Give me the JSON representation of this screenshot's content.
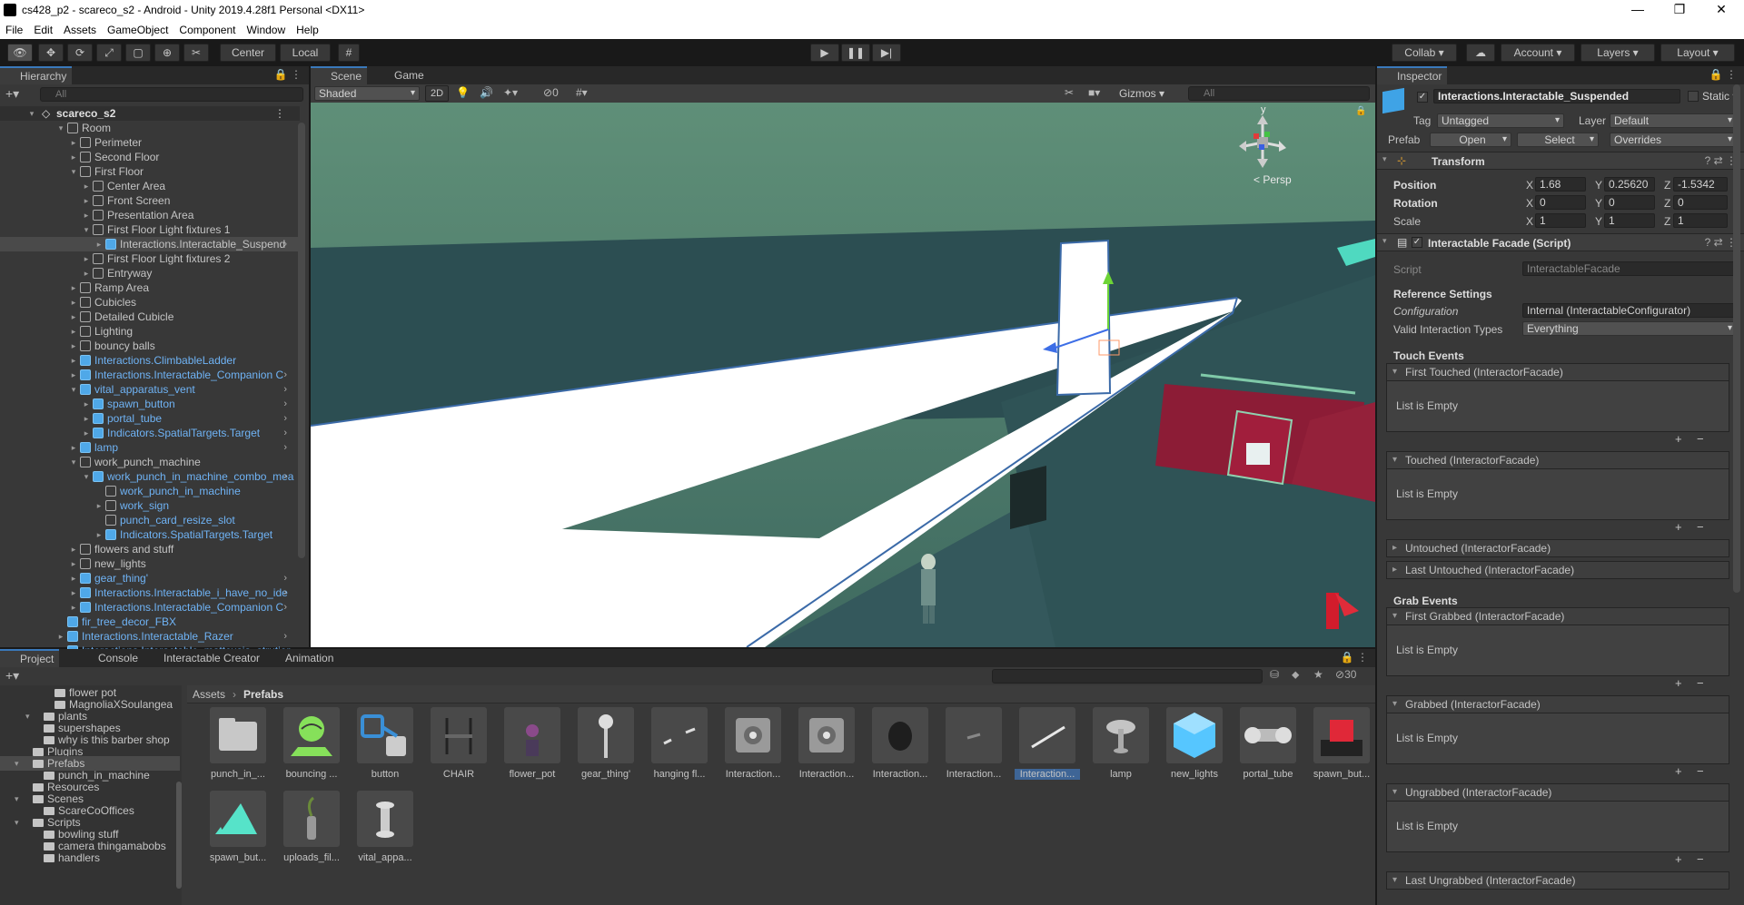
{
  "window": {
    "title": "cs428_p2 - scareco_s2 - Android - Unity 2019.4.28f1 Personal <DX11>"
  },
  "menu": [
    "File",
    "Edit",
    "Assets",
    "GameObject",
    "Component",
    "Window",
    "Help"
  ],
  "toolbar": {
    "pivot": "Center",
    "space": "Local",
    "collab": "Collab",
    "account": "Account",
    "layers": "Layers",
    "layout": "Layout"
  },
  "hierarchy": {
    "tab": "Hierarchy",
    "search_placeholder": "All",
    "scene": "scareco_s2",
    "rows": [
      {
        "label": "Room",
        "depth": 1,
        "exp": "open",
        "icon": "gray",
        "blue": false
      },
      {
        "label": "Perimeter",
        "depth": 2,
        "exp": "closed",
        "icon": "gray",
        "blue": false
      },
      {
        "label": "Second Floor",
        "depth": 2,
        "exp": "closed",
        "icon": "gray",
        "blue": false
      },
      {
        "label": "First Floor",
        "depth": 2,
        "exp": "open",
        "icon": "gray",
        "blue": false
      },
      {
        "label": "Center Area",
        "depth": 3,
        "exp": "closed",
        "icon": "gray",
        "blue": false
      },
      {
        "label": "Front Screen",
        "depth": 3,
        "exp": "closed",
        "icon": "gray",
        "blue": false
      },
      {
        "label": "Presentation Area",
        "depth": 3,
        "exp": "closed",
        "icon": "gray",
        "blue": false
      },
      {
        "label": "First Floor Light fixtures 1",
        "depth": 3,
        "exp": "open",
        "icon": "gray",
        "blue": false
      },
      {
        "label": "Interactions.Interactable_Suspend",
        "depth": 4,
        "exp": "closed",
        "icon": "blue",
        "blue": false,
        "sel": true,
        "more": true
      },
      {
        "label": "First Floor Light fixtures 2",
        "depth": 3,
        "exp": "closed",
        "icon": "gray",
        "blue": false
      },
      {
        "label": "Entryway",
        "depth": 3,
        "exp": "closed",
        "icon": "gray",
        "blue": false
      },
      {
        "label": "Ramp Area",
        "depth": 2,
        "exp": "closed",
        "icon": "gray",
        "blue": false
      },
      {
        "label": "Cubicles",
        "depth": 2,
        "exp": "closed",
        "icon": "gray",
        "blue": false
      },
      {
        "label": "Detailed Cubicle",
        "depth": 2,
        "exp": "closed",
        "icon": "gray",
        "blue": false
      },
      {
        "label": "Lighting",
        "depth": 2,
        "exp": "closed",
        "icon": "gray",
        "blue": false
      },
      {
        "label": "bouncy balls",
        "depth": 2,
        "exp": "closed",
        "icon": "gray",
        "blue": false
      },
      {
        "label": "Interactions.ClimbableLadder",
        "depth": 2,
        "exp": "closed",
        "icon": "blue",
        "blue": true
      },
      {
        "label": "Interactions.Interactable_Companion C",
        "depth": 2,
        "exp": "closed",
        "icon": "blue",
        "blue": true,
        "more": true
      },
      {
        "label": "vital_apparatus_vent",
        "depth": 2,
        "exp": "open",
        "icon": "blue",
        "blue": true,
        "more": true
      },
      {
        "label": "spawn_button",
        "depth": 3,
        "exp": "closed",
        "icon": "blue",
        "blue": true,
        "more": true
      },
      {
        "label": "portal_tube",
        "depth": 3,
        "exp": "closed",
        "icon": "blue",
        "blue": true,
        "more": true
      },
      {
        "label": "Indicators.SpatialTargets.Target",
        "depth": 3,
        "exp": "closed",
        "icon": "blue",
        "blue": true,
        "more": true
      },
      {
        "label": "lamp",
        "depth": 2,
        "exp": "closed",
        "icon": "blue",
        "blue": true,
        "more": true
      },
      {
        "label": "work_punch_machine",
        "depth": 2,
        "exp": "open",
        "icon": "gray",
        "blue": false
      },
      {
        "label": "work_punch_in_machine_combo_mea",
        "depth": 3,
        "exp": "open",
        "icon": "blue",
        "blue": true,
        "more": true
      },
      {
        "label": "work_punch_in_machine",
        "depth": 4,
        "exp": "none",
        "icon": "gray",
        "blue": true
      },
      {
        "label": "work_sign",
        "depth": 4,
        "exp": "closed",
        "icon": "gray",
        "blue": true
      },
      {
        "label": "punch_card_resize_slot",
        "depth": 4,
        "exp": "none",
        "icon": "gray",
        "blue": true
      },
      {
        "label": "Indicators.SpatialTargets.Target",
        "depth": 4,
        "exp": "closed",
        "icon": "blue",
        "blue": true
      },
      {
        "label": "flowers and stuff",
        "depth": 2,
        "exp": "closed",
        "icon": "gray",
        "blue": false
      },
      {
        "label": "new_lights",
        "depth": 2,
        "exp": "closed",
        "icon": "gray",
        "blue": false
      },
      {
        "label": "gear_thing'",
        "depth": 2,
        "exp": "closed",
        "icon": "blue",
        "blue": true,
        "more": true
      },
      {
        "label": "Interactions.Interactable_i_have_no_ide",
        "depth": 2,
        "exp": "closed",
        "icon": "blue",
        "blue": true,
        "more": true
      },
      {
        "label": "Interactions.Interactable_Companion C",
        "depth": 2,
        "exp": "closed",
        "icon": "blue",
        "blue": true,
        "more": true
      },
      {
        "label": "fir_tree_decor_FBX",
        "depth": 1,
        "exp": "none",
        "icon": "blue",
        "blue": true
      },
      {
        "label": "Interactions.Interactable_Razer",
        "depth": 1,
        "exp": "closed",
        "icon": "blue",
        "blue": true,
        "more": true
      },
      {
        "label": "Interactions.Interactable_mattcusia_strutier",
        "depth": 1,
        "exp": "closed",
        "icon": "blue",
        "blue": true
      }
    ]
  },
  "scene": {
    "tab_scene": "Scene",
    "tab_game": "Game",
    "shading": "Shaded",
    "mode2d": "2D",
    "hidden_count": "0",
    "gizmos": "Gizmos",
    "search_placeholder": "All",
    "persp": "Persp",
    "axis_y": "y"
  },
  "inspector": {
    "tab": "Inspector",
    "object_name": "Interactions.Interactable_Suspended",
    "static": "Static",
    "tag_label": "Tag",
    "tag": "Untagged",
    "layer_label": "Layer",
    "layer": "Default",
    "prefab_label": "Prefab",
    "open": "Open",
    "select": "Select",
    "overrides": "Overrides",
    "transform": "Transform",
    "position_label": "Position",
    "pos_x": "1.68",
    "pos_y": "0.25620",
    "pos_z": "-1.5342",
    "rotation_label": "Rotation",
    "rot_x": "0",
    "rot_y": "0",
    "rot_z": "0",
    "scale_label": "Scale",
    "scl_x": "1",
    "scl_y": "1",
    "scl_z": "1",
    "component": "Interactable Facade (Script)",
    "script_label": "Script",
    "script": "InteractableFacade",
    "ref_settings": "Reference Settings",
    "config_label": "Configuration",
    "config": "Internal (InteractableConfigurator)",
    "valid_label": "Valid Interaction Types",
    "valid": "Everything",
    "touch_events": "Touch Events",
    "grab_events": "Grab Events",
    "ev_first_touched": "First Touched (InteractorFacade)",
    "ev_touched": "Touched (InteractorFacade)",
    "ev_untouched": "Untouched (InteractorFacade)",
    "ev_last_untouched": "Last Untouched (InteractorFacade)",
    "ev_first_grabbed": "First Grabbed (InteractorFacade)",
    "ev_grabbed": "Grabbed (InteractorFacade)",
    "ev_ungrabbed": "Ungrabbed (InteractorFacade)",
    "ev_last_ungrabbed": "Last Ungrabbed (InteractorFacade)",
    "list_empty": "List is Empty"
  },
  "project": {
    "tabs": [
      "Project",
      "Console",
      "Interactable Creator",
      "Animation"
    ],
    "hidden_count": "30",
    "breadcrumb_root": "Assets",
    "breadcrumb_leaf": "Prefabs",
    "tree": [
      {
        "label": "flower pot",
        "depth": 2,
        "exp": false
      },
      {
        "label": "MagnoliaXSoulangea",
        "depth": 2,
        "exp": false
      },
      {
        "label": "plants",
        "depth": 1,
        "exp": true
      },
      {
        "label": "supershapes",
        "depth": 1,
        "exp": false
      },
      {
        "label": "why is this barber shop",
        "depth": 1,
        "exp": false
      },
      {
        "label": "Plugins",
        "depth": 0,
        "exp": false
      },
      {
        "label": "Prefabs",
        "depth": 0,
        "exp": true,
        "sel": true
      },
      {
        "label": "punch_in_machine",
        "depth": 1,
        "exp": false
      },
      {
        "label": "Resources",
        "depth": 0,
        "exp": false
      },
      {
        "label": "Scenes",
        "depth": 0,
        "exp": true
      },
      {
        "label": "ScareCoOffices",
        "depth": 1,
        "exp": false
      },
      {
        "label": "Scripts",
        "depth": 0,
        "exp": true
      },
      {
        "label": "bowling stuff",
        "depth": 1,
        "exp": false
      },
      {
        "label": "camera thingamabobs",
        "depth": 1,
        "exp": false
      },
      {
        "label": "handlers",
        "depth": 1,
        "exp": false
      }
    ],
    "assets": [
      {
        "name": "punch_in_...",
        "kind": "folder"
      },
      {
        "name": "bouncing ...",
        "kind": "bouncing"
      },
      {
        "name": "button",
        "kind": "button"
      },
      {
        "name": "CHAIR",
        "kind": "chair"
      },
      {
        "name": "flower_pot",
        "kind": "flower"
      },
      {
        "name": "gear_thing'",
        "kind": "gear"
      },
      {
        "name": "hanging fl...",
        "kind": "hanging"
      },
      {
        "name": "Interaction...",
        "kind": "cube"
      },
      {
        "name": "Interaction...",
        "kind": "cube"
      },
      {
        "name": "Interaction...",
        "kind": "ball"
      },
      {
        "name": "Interaction...",
        "kind": "flat"
      },
      {
        "name": "Interaction...",
        "kind": "line",
        "sel": true
      },
      {
        "name": "lamp",
        "kind": "lamp"
      },
      {
        "name": "new_lights",
        "kind": "bluecube"
      },
      {
        "name": "portal_tube",
        "kind": "tube"
      },
      {
        "name": "spawn_but...",
        "kind": "redbtn"
      },
      {
        "name": "spawn_but...",
        "kind": "tri"
      },
      {
        "name": "uploads_fil...",
        "kind": "vase"
      },
      {
        "name": "vital_appa...",
        "kind": "vital"
      }
    ]
  }
}
